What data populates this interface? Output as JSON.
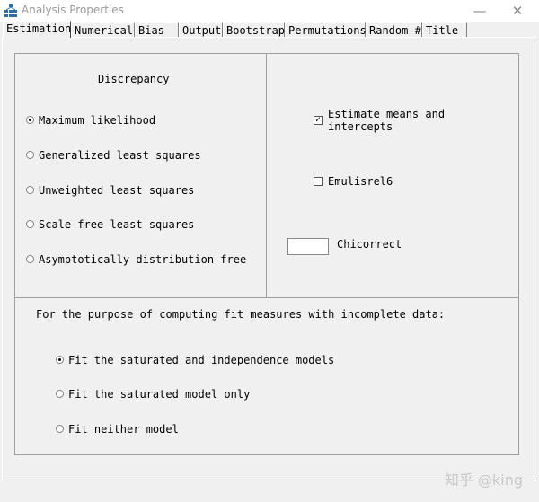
{
  "window": {
    "title": "Analysis Properties",
    "minimize_glyph": "—",
    "close_glyph": "✕",
    "icon": "amos-network-icon"
  },
  "tabs": [
    {
      "label": "Estimation",
      "active": true
    },
    {
      "label": "Numerical",
      "active": false
    },
    {
      "label": "Bias",
      "active": false
    },
    {
      "label": "Output",
      "active": false
    },
    {
      "label": "Bootstrap",
      "active": false
    },
    {
      "label": "Permutations",
      "active": false
    },
    {
      "label": "Random #",
      "active": false
    },
    {
      "label": "Title",
      "active": false
    }
  ],
  "discrepancy": {
    "heading": "Discrepancy",
    "options": [
      {
        "label": "Maximum likelihood",
        "selected": true
      },
      {
        "label": "Generalized least squares",
        "selected": false
      },
      {
        "label": "Unweighted least squares",
        "selected": false
      },
      {
        "label": "Scale-free least squares",
        "selected": false
      },
      {
        "label": "Asymptotically distribution-free",
        "selected": false
      }
    ]
  },
  "options": {
    "estimate_means_line1": "Estimate means and",
    "estimate_means_line2": "intercepts",
    "estimate_means_checked": true,
    "emulisrel_label": "Emulisrel6",
    "emulisrel_checked": false,
    "chicorrect_label": "Chicorrect",
    "chicorrect_value": ""
  },
  "incomplete": {
    "heading": "For the purpose of computing fit measures with incomplete data:",
    "options": [
      {
        "label": "Fit the saturated and independence models",
        "selected": true
      },
      {
        "label": "Fit the saturated model only",
        "selected": false
      },
      {
        "label": "Fit neither model",
        "selected": false
      }
    ]
  },
  "watermark": "知乎 @king"
}
